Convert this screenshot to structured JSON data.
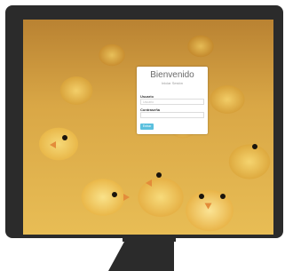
{
  "login": {
    "title": "Bienvenido",
    "subtitle": "Iniciar Sesión",
    "username_label": "Usuario",
    "username_placeholder": "Usuario",
    "password_label": "Contraseña",
    "password_placeholder": "",
    "submit_label": "Entrar"
  },
  "colors": {
    "monitor": "#2b2b2b",
    "button": "#5bc0de"
  }
}
